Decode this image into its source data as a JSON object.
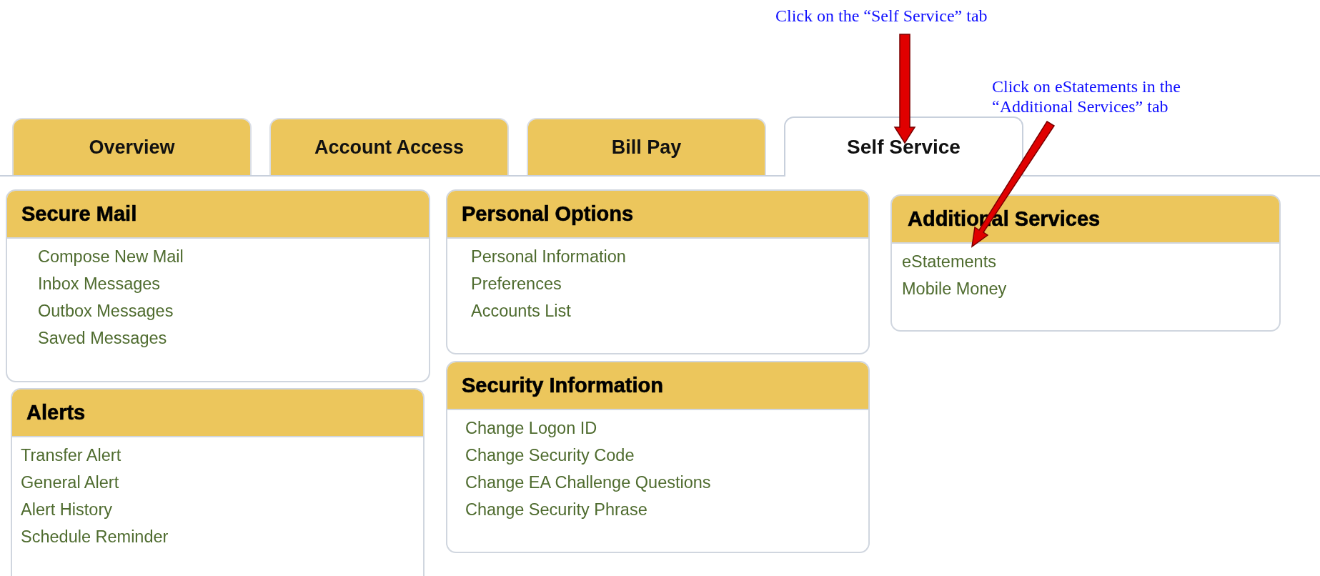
{
  "tabs": [
    {
      "label": "Overview",
      "selected": false
    },
    {
      "label": "Account Access",
      "selected": false
    },
    {
      "label": "Bill Pay",
      "selected": false
    },
    {
      "label": "Self Service",
      "selected": true
    }
  ],
  "columns": [
    [
      {
        "title": "Secure Mail",
        "items": [
          "Compose New Mail",
          "Inbox Messages",
          "Outbox Messages",
          "Saved Messages"
        ]
      },
      {
        "title": "Alerts",
        "items": [
          "Transfer Alert",
          "General Alert",
          "Alert History",
          "Schedule Reminder"
        ]
      }
    ],
    [
      {
        "title": "Personal Options",
        "items": [
          "Personal Information",
          "Preferences",
          "Accounts List"
        ]
      },
      {
        "title": "Security Information",
        "items": [
          "Change Logon ID",
          "Change Security Code",
          "Change EA Challenge Questions",
          "Change Security Phrase"
        ]
      }
    ],
    [
      {
        "title": "Additional Services",
        "items": [
          "eStatements",
          "Mobile Money"
        ]
      }
    ]
  ],
  "annotations": [
    {
      "kind": "vertical",
      "text": "Click on the “Self Service” tab"
    },
    {
      "kind": "diagonal",
      "text": "Click on eStatements in the\n“Additional Services” tab"
    }
  ]
}
